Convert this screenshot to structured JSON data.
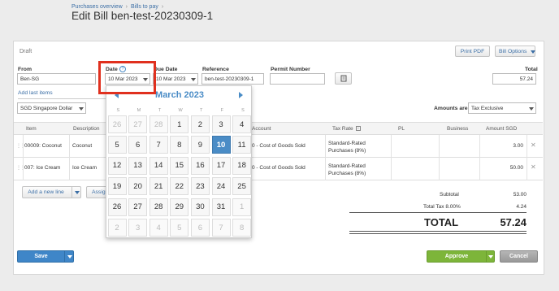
{
  "breadcrumb": {
    "item1": "Purchases overview",
    "sep": "›",
    "item2": "Bills to pay",
    "sep2": "›"
  },
  "page": {
    "title": "Edit Bill ben-test-20230309-1",
    "status": "Draft"
  },
  "toolbar": {
    "print_pdf": "Print PDF",
    "bill_options": "Bill Options"
  },
  "form": {
    "from_label": "From",
    "from_value": "Ben-SG",
    "date_label": "Date",
    "date_value": "10 Mar 2023",
    "date_help": "?",
    "due_label": "Due Date",
    "due_value": "10 Mar 2023",
    "ref_label": "Reference",
    "ref_value": "ben-test-20230309-1",
    "permit_label": "Permit Number",
    "permit_value": "",
    "total_label": "Total",
    "total_value": "57.24",
    "add_last_items": "Add last items",
    "currency": "SGD Singapore Dollar",
    "amounts_label": "Amounts are",
    "amounts_value": "Tax Exclusive"
  },
  "table": {
    "headers": {
      "item": "Item",
      "description": "Description",
      "account": "Account",
      "tax_rate": "Tax Rate",
      "pl": "PL",
      "business": "Business",
      "amount": "Amount SGD"
    },
    "rows": [
      {
        "item": "00009: Coconut",
        "description": "Coconut",
        "account": "0 - Cost of Goods Sold",
        "tax_rate": "Standard-Rated Purchases (8%)",
        "amount": "3.00"
      },
      {
        "item": "007: Ice Cream",
        "description": "Ice Cream",
        "account": "0 - Cost of Goods Sold",
        "tax_rate": "Standard-Rated Purchases (8%)",
        "amount": "50.00"
      }
    ],
    "add_line": "Add a new line",
    "assign": "Assig"
  },
  "totals": {
    "subtotal_label": "Subtotal",
    "subtotal": "53.00",
    "tax_label": "Total Tax 8.00%",
    "tax": "4.24",
    "total_label": "TOTAL",
    "total": "57.24"
  },
  "footer": {
    "save": "Save",
    "approve": "Approve",
    "cancel": "Cancel"
  },
  "calendar": {
    "month": "March 2023",
    "weekdays": [
      "S",
      "M",
      "T",
      "W",
      "T",
      "F",
      "S"
    ],
    "weeks": [
      [
        "26",
        "27",
        "28",
        "1",
        "2",
        "3",
        "4"
      ],
      [
        "5",
        "6",
        "7",
        "8",
        "9",
        "10",
        "11"
      ],
      [
        "12",
        "13",
        "14",
        "15",
        "16",
        "17",
        "18"
      ],
      [
        "19",
        "20",
        "21",
        "22",
        "23",
        "24",
        "25"
      ],
      [
        "26",
        "27",
        "28",
        "29",
        "30",
        "31",
        "1"
      ],
      [
        "2",
        "3",
        "4",
        "5",
        "6",
        "7",
        "8"
      ]
    ],
    "selected": "10"
  },
  "colors": {
    "accent": "#4a8cc6",
    "approve": "#7db53a",
    "save": "#3f86c8",
    "highlight": "#e0301e"
  }
}
